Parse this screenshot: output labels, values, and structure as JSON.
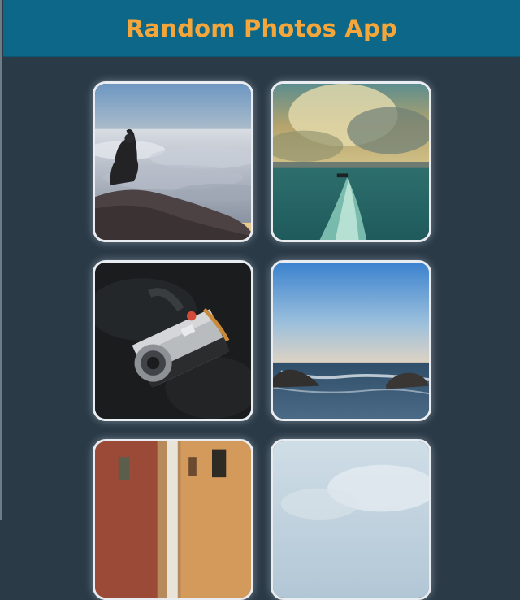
{
  "header": {
    "title": "Random Photos App"
  },
  "colors": {
    "background": "#2b3a47",
    "header_bg": "#0c6788",
    "title": "#f4a63a",
    "card_border": "#e9edf1"
  },
  "photos": [
    {
      "subject": "person sitting on rock above sea of clouds"
    },
    {
      "subject": "boat wake on sea under dramatic clouds"
    },
    {
      "subject": "silver rangefinder camera on dark bag"
    },
    {
      "subject": "ocean waves breaking on rocks under blue sky"
    },
    {
      "subject": "narrow street between old buildings"
    },
    {
      "subject": "pale cloudy sky"
    }
  ]
}
